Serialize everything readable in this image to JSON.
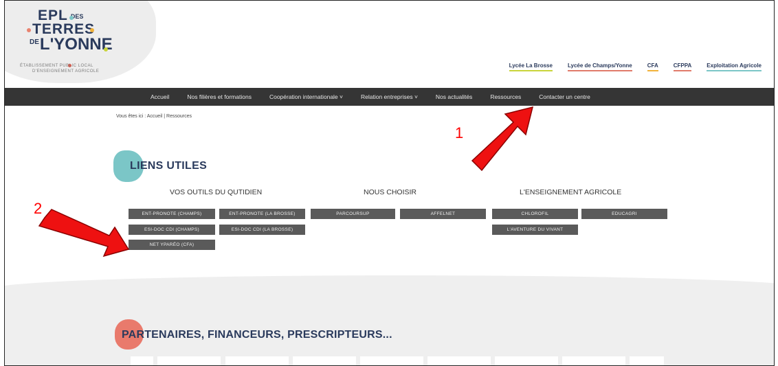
{
  "header": {
    "logo": {
      "line1": "EPL",
      "line1_small": "DES",
      "line2": "TERRES",
      "line3_small": "DE",
      "line3": "L'YONNE",
      "tagline1": "ÉTABLISSEMENT PUBLIC LOCAL",
      "tagline2": "D'ENSEIGNEMENT AGRICOLE"
    },
    "top_links": [
      {
        "label": "Lycée La Brosse",
        "color": "#c9d43a"
      },
      {
        "label": "Lycée de Champs/Yonne",
        "color": "#e07a6a"
      },
      {
        "label": "CFA",
        "color": "#f2b23a"
      },
      {
        "label": "CFPPA",
        "color": "#e07a6a"
      },
      {
        "label": "Exploitation Agricole",
        "color": "#7bc6c7"
      }
    ]
  },
  "nav": {
    "items": [
      "Accueil",
      "Nos filières et formations",
      "Coopération internationale ˅",
      "Relation entreprises ˅",
      "Nos actualités",
      "Ressources",
      "Contacter un centre"
    ]
  },
  "breadcrumb": "Vous êtes ici : Accueil | Ressources",
  "liens_utiles": {
    "title": "LIENS UTILES",
    "columns": [
      {
        "title": "VOS OUTILS DU QUTIDIEN",
        "links": [
          "ENT-PRONOTE (CHAMPS)",
          "ENT-PRONOTE (LA BROSSE)",
          "ESI-DOC CDI (CHAMPS)",
          "ESI-DOC CDI (LA BROSSE)",
          "NET YPARÉO (CFA)"
        ]
      },
      {
        "title": "NOUS CHOISIR",
        "links": [
          "PARCOURSUP",
          "AFFELNET"
        ]
      },
      {
        "title": "L'ENSEIGNEMENT AGRICOLE",
        "links": [
          "CHLOROFIL",
          "EDUCAGRI",
          "L'AVENTURE DU VIVANT"
        ]
      }
    ]
  },
  "partners": {
    "title": "PARTENAIRES, FINANCEURS, PRESCRIPTEURS..."
  },
  "annotations": {
    "label1": "1",
    "label2": "2",
    "arrow_color": "#ff0000"
  },
  "colors": {
    "nav_bg": "#353535",
    "button_bg": "#5a5a5a",
    "title_color": "#2a3a5c",
    "teal_blob": "#7bc6c7",
    "salmon_blob": "#e97a6c"
  }
}
